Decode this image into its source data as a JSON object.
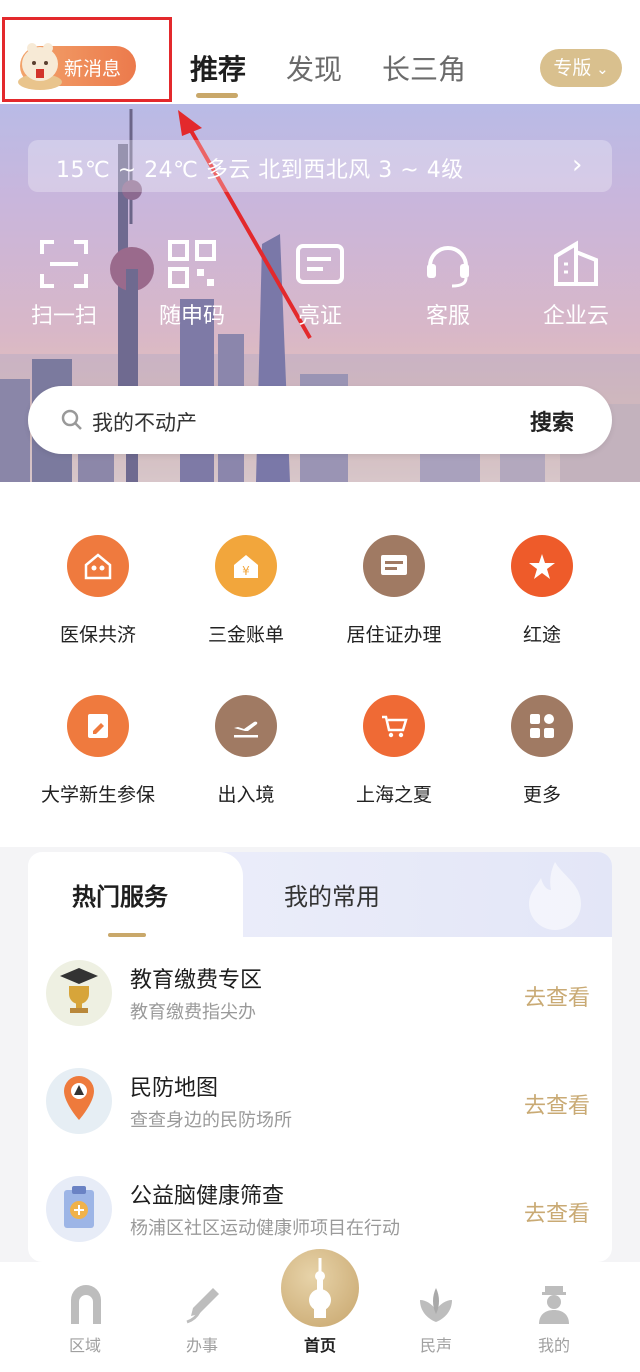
{
  "header": {
    "badge_text": "新消息",
    "tabs": [
      {
        "label": "推荐"
      },
      {
        "label": "发现"
      },
      {
        "label": "长三角"
      }
    ],
    "edition_label": "专版"
  },
  "weather": {
    "text": "15℃ ~ 24℃  多云  北到西北风  3 ~ 4级",
    "chevron": "›"
  },
  "quick_actions": [
    {
      "label": "扫一扫",
      "icon": "scan-icon"
    },
    {
      "label": "随申码",
      "icon": "qr-code-icon"
    },
    {
      "label": "亮证",
      "icon": "card-icon"
    },
    {
      "label": "客服",
      "icon": "headset-icon"
    },
    {
      "label": "企业云",
      "icon": "building-icon"
    }
  ],
  "search": {
    "placeholder": "我的不动产",
    "button": "搜索"
  },
  "services": [
    {
      "label": "医保共济",
      "icon": "family-house-icon",
      "color": "#ef7a3e"
    },
    {
      "label": "三金账单",
      "icon": "yen-house-icon",
      "color": "#f2a63c"
    },
    {
      "label": "居住证办理",
      "icon": "residence-card-icon",
      "color": "#a07a63"
    },
    {
      "label": "红途",
      "icon": "red-star-icon",
      "color": "#ee5b2a"
    },
    {
      "label": "大学新生参保",
      "icon": "document-pen-icon",
      "color": "#ef7a3e"
    },
    {
      "label": "出入境",
      "icon": "airplane-icon",
      "color": "#a07a63"
    },
    {
      "label": "上海之夏",
      "icon": "shopping-cart-icon",
      "color": "#ef6a35"
    },
    {
      "label": "更多",
      "icon": "more-apps-icon",
      "color": "#a07a63"
    }
  ],
  "card": {
    "tabs": [
      "热门服务",
      "我的常用"
    ],
    "rows": [
      {
        "title": "教育缴费专区",
        "subtitle": "教育缴费指尖办",
        "action": "去查看",
        "icon": "graduation-trophy-icon"
      },
      {
        "title": "民防地图",
        "subtitle": "查查身边的民防场所",
        "action": "去查看",
        "icon": "map-pin-icon"
      },
      {
        "title": "公益脑健康筛查",
        "subtitle": "杨浦区社区运动健康师项目在行动",
        "action": "去查看",
        "icon": "brain-clipboard-icon"
      }
    ]
  },
  "bottom_nav": [
    {
      "label": "区域",
      "icon": "arch-icon"
    },
    {
      "label": "办事",
      "icon": "pen-nib-icon"
    },
    {
      "label": "首页",
      "icon": "pearl-tower-icon"
    },
    {
      "label": "民声",
      "icon": "magnolia-icon"
    },
    {
      "label": "我的",
      "icon": "person-icon"
    }
  ],
  "colors": {
    "accent_gold": "#c9a86a",
    "highlight_red": "#e3292c",
    "badge_orange": "#ec7a4c"
  }
}
